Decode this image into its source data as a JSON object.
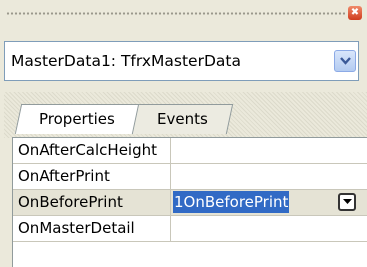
{
  "window": {
    "close_glyph": "✖"
  },
  "object_selector": {
    "value": "MasterData1: TfrxMasterData"
  },
  "tabs": [
    {
      "label": "Properties",
      "active": false
    },
    {
      "label": "Events",
      "active": true
    }
  ],
  "events": [
    {
      "name": "OnAfterCalcHeight",
      "value": ""
    },
    {
      "name": "OnAfterPrint",
      "value": ""
    },
    {
      "name": "OnBeforePrint",
      "value": "1OnBeforePrint",
      "selected": true
    },
    {
      "name": "OnMasterDetail",
      "value": ""
    }
  ]
}
